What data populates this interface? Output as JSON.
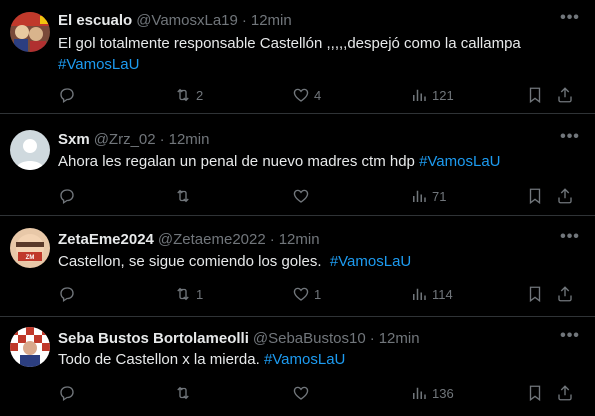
{
  "tweets": [
    {
      "name": "El escualo",
      "handle": "@VamosxLa19",
      "time": "12min",
      "text": "El gol totalmente responsable Castellón ,,,,,despejó como la callampa",
      "hashtag": "#VamosLaU",
      "hashtag_on_new_line": true,
      "replies": "",
      "retweets": "2",
      "likes": "4",
      "views": "121"
    },
    {
      "name": "Sxm",
      "handle": "@Zrz_02",
      "time": "12min",
      "text": "Ahora les regalan un penal de nuevo madres ctm hdp",
      "hashtag": "#VamosLaU",
      "hashtag_on_new_line": false,
      "replies": "",
      "retweets": "",
      "likes": "",
      "views": "71"
    },
    {
      "name": "ZetaEme2024",
      "handle": "@Zetaeme2022",
      "time": "12min",
      "text": "Castellon, se sigue comiendo los goles.",
      "hashtag": "#VamosLaU",
      "hashtag_on_new_line": false,
      "replies": "",
      "retweets": "1",
      "likes": "1",
      "views": "114"
    },
    {
      "name": "Seba Bustos Bortolameolli",
      "handle": "@SebaBustos10",
      "time": "12min",
      "text": "Todo de Castellon x la mierda.",
      "hashtag": "#VamosLaU",
      "hashtag_on_new_line": false,
      "replies": "",
      "retweets": "",
      "likes": "",
      "views": "136"
    }
  ],
  "separator": "·",
  "colors": {
    "background": "#000000",
    "text": "#e7e9ea",
    "muted": "#71767b",
    "hashtag": "#1d9bf0",
    "divider": "#2f3336"
  },
  "icons": [
    "reply-icon",
    "retweet-icon",
    "like-icon",
    "views-icon",
    "bookmark-icon",
    "share-icon",
    "more-icon"
  ]
}
